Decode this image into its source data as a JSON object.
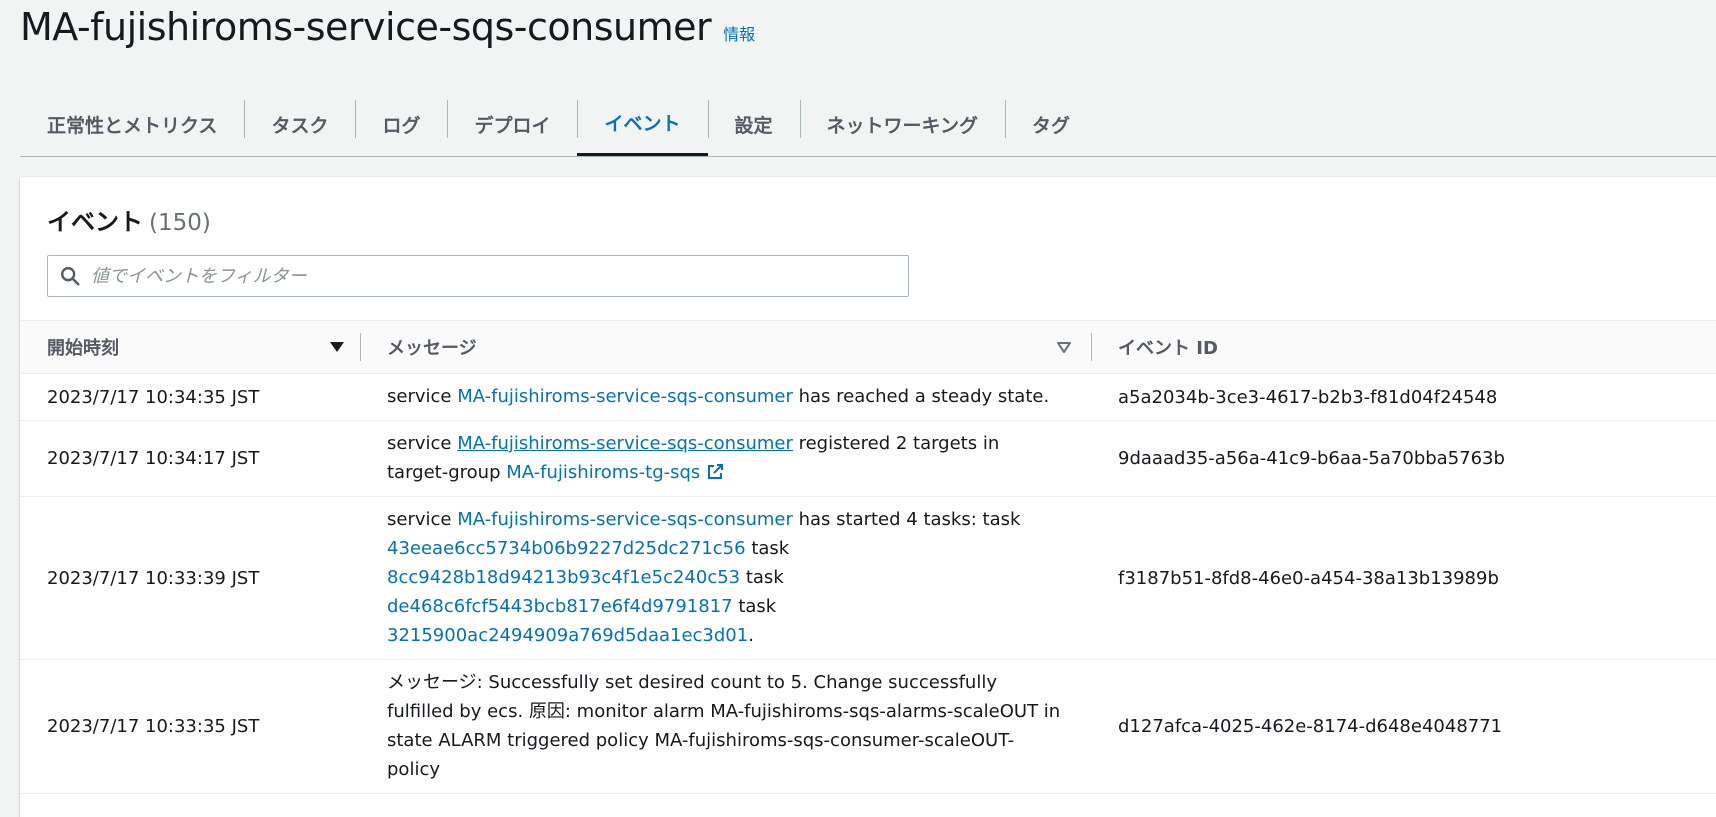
{
  "page": {
    "title": "MA-fujishiroms-service-sqs-consumer",
    "info_link": "情報"
  },
  "tabs": [
    "正常性とメトリクス",
    "タスク",
    "ログ",
    "デプロイ",
    "イベント",
    "設定",
    "ネットワーキング",
    "タグ"
  ],
  "active_tab": "イベント",
  "events_panel": {
    "title": "イベント",
    "count": "(150)",
    "filter_placeholder": "値でイベントをフィルター",
    "columns": {
      "start_time": "開始時刻",
      "message": "メッセージ",
      "event_id": "イベント ID"
    },
    "rows": [
      {
        "time": "2023/7/17 10:34:35 JST",
        "message": [
          {
            "t": "service "
          },
          {
            "t": "MA-fujishiroms-service-sqs-consumer",
            "link": true
          },
          {
            "t": " has reached a steady state."
          }
        ],
        "event_id": "a5a2034b-3ce3-4617-b2b3-f81d04f24548"
      },
      {
        "time": "2023/7/17 10:34:17 JST",
        "message": [
          {
            "t": "service "
          },
          {
            "t": "MA-fujishiroms-service-sqs-consumer",
            "link": true,
            "underline": true
          },
          {
            "t": " registered 2 targets in target-group "
          },
          {
            "t": "MA-fujishiroms-tg-sqs",
            "link": true,
            "external": true
          }
        ],
        "event_id": "9daaad35-a56a-41c9-b6aa-5a70bba5763b"
      },
      {
        "time": "2023/7/17 10:33:39 JST",
        "message": [
          {
            "t": "service "
          },
          {
            "t": "MA-fujishiroms-service-sqs-consumer",
            "link": true
          },
          {
            "t": " has started 4 tasks: task "
          },
          {
            "t": "43eeae6cc5734b06b9227d25dc271c56",
            "link": true
          },
          {
            "t": " task "
          },
          {
            "t": "8cc9428b18d94213b93c4f1e5c240c53",
            "link": true
          },
          {
            "t": " task "
          },
          {
            "t": "de468c6fcf5443bcb817e6f4d9791817",
            "link": true
          },
          {
            "t": " task "
          },
          {
            "t": "3215900ac2494909a769d5daa1ec3d01",
            "link": true
          },
          {
            "t": "."
          }
        ],
        "event_id": "f3187b51-8fd8-46e0-a454-38a13b13989b"
      },
      {
        "time": "2023/7/17 10:33:35 JST",
        "message": [
          {
            "t": "メッセージ: Successfully set desired count to 5. Change successfully fulfilled by ecs. 原因: monitor alarm MA-fujishiroms-sqs-alarms-scaleOUT in state ALARM triggered policy MA-fujishiroms-sqs-consumer-scaleOUT-policy"
          }
        ],
        "event_id": "d127afca-4025-462e-8174-d648e4048771"
      }
    ]
  },
  "colors": {
    "link": "#0073bb",
    "text": "#16191f",
    "muted": "#545b64",
    "background": "#f2f3f3"
  }
}
